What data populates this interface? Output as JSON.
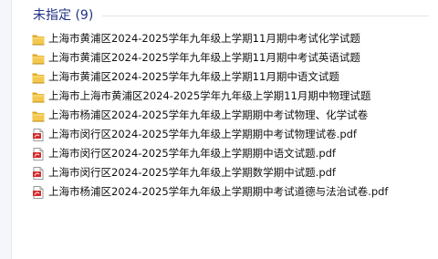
{
  "group": {
    "title": "未指定 (9)"
  },
  "files": [
    {
      "name": "上海市黄浦区2024-2025学年九年级上学期11月期中考试化学试题",
      "type": "folder",
      "icon": "folder-icon"
    },
    {
      "name": "上海市黄浦区2024-2025学年九年级上学期11月期中考试英语试题",
      "type": "folder",
      "icon": "folder-icon"
    },
    {
      "name": "上海市黄浦区2024-2025学年九年级上学期11月期中语文试题",
      "type": "folder",
      "icon": "folder-icon"
    },
    {
      "name": "上海市上海市黄浦区2024-2025学年九年级上学期11月期中物理试题",
      "type": "folder",
      "icon": "folder-icon"
    },
    {
      "name": "上海市杨浦区2024-2025学年九年级上学期期中考试物理、化学试卷",
      "type": "folder",
      "icon": "folder-icon"
    },
    {
      "name": "上海市闵行区2024-2025学年九年级上学期期中考试物理试卷.pdf",
      "type": "pdf",
      "icon": "pdf-icon"
    },
    {
      "name": "上海市闵行区2024-2025学年九年级上学期期中语文试题.pdf",
      "type": "pdf",
      "icon": "pdf-icon"
    },
    {
      "name": "上海市闵行区2024-2025学年九年级上学期数学期中试题.pdf",
      "type": "pdf",
      "icon": "pdf-icon"
    },
    {
      "name": "上海市杨浦区2024-2025学年九年级上学期期中考试道德与法治试卷.pdf",
      "type": "pdf",
      "icon": "pdf-icon"
    }
  ],
  "colors": {
    "group_title": "#1e3287",
    "folder_body": "#f2c64d",
    "folder_tab": "#d9a520",
    "pdf_red": "#d42a2a"
  }
}
